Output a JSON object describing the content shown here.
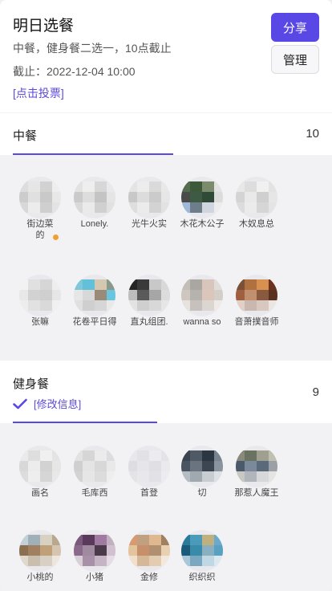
{
  "header": {
    "title": "明日选餐",
    "subtitle": "中餐，健身餐二选一，10点截止",
    "deadline": "截止：2022-12-04 10:00",
    "vote_link": "[点击投票]",
    "share_label": "分享",
    "manage_label": "管理"
  },
  "sections": [
    {
      "title": "中餐",
      "count": "10",
      "voters": [
        {
          "name": "街边菜",
          "name2": "的",
          "palette": [
            "#ddd",
            "#e6e6e6",
            "#d2d2d2",
            "#eee",
            "#ccc",
            "#e0e0e0",
            "#c9c9c9",
            "#e8e8e8",
            "#d8d8d8",
            "#ececec",
            "#cfcfcf",
            "#e3e3e3"
          ]
        },
        {
          "name": "Lonely.",
          "palette": [
            "#e2e2e2",
            "#eee",
            "#d7d7d7",
            "#e9e9e9",
            "#cacaca",
            "#ddd",
            "#c4c4c4",
            "#e5e5e5",
            "#d9d9d9",
            "#eaeaea",
            "#d0d0d0",
            "#e1e1e1"
          ]
        },
        {
          "name": "光牛火实",
          "palette": [
            "#e4e4e4",
            "#ececec",
            "#dadada",
            "#e8e8e8",
            "#c8c8c8",
            "#dcdcdc",
            "#cbcbcb",
            "#e6e6e6",
            "#dedede",
            "#ebebeb",
            "#d3d3d3",
            "#e2e2e2"
          ]
        },
        {
          "name": "木花木公子",
          "palette": [
            "#556b4d",
            "#3c5a3a",
            "#7a8c6c",
            "#e2e2e2",
            "#4a4a4a",
            "#3e5a44",
            "#2f4a36",
            "#dcdcdc",
            "#a0b8d8",
            "#6d7d8a",
            "#d0d6e0",
            "#ececec"
          ]
        },
        {
          "name": "木奴息总",
          "palette": [
            "#e8e8e8",
            "#dddddd",
            "#f0f0f0",
            "#e3e3e3",
            "#d4d4d4",
            "#e9e9e9",
            "#cfcfcf",
            "#e6e6e6",
            "#dcdcdc",
            "#ebebeb",
            "#d6d6d6",
            "#e4e4e4"
          ]
        },
        {
          "name": "张嘛",
          "palette": [
            "#f2f2f2",
            "#e0e0e0",
            "#d6d6d6",
            "#eeeeee",
            "#e8e8e8",
            "#d2d2d2",
            "#cfcfcf",
            "#e6e6e6",
            "#ededed",
            "#e1e1e1",
            "#d9d9d9",
            "#f0f0f0"
          ]
        },
        {
          "name": "花卷平日得",
          "palette": [
            "#7fc8d8",
            "#62c0d8",
            "#d4c8b0",
            "#8a9a8a",
            "#e6e6e6",
            "#d8d8d8",
            "#9a8a7a",
            "#6ac6de",
            "#e0e0e0",
            "#cfcfcf",
            "#d6d6d6",
            "#e9e9e9"
          ]
        },
        {
          "name": "直丸组团.",
          "palette": [
            "#262626",
            "#3a3a3a",
            "#c8c8c8",
            "#d8d8d8",
            "#bdbdbd",
            "#5a5a5a",
            "#a6a6a6",
            "#dcdcdc",
            "#e3e3e3",
            "#cfcfcf",
            "#d8d8d8",
            "#e6e6e6"
          ]
        },
        {
          "name": "wanna so",
          "palette": [
            "#c4beb8",
            "#aaa6a2",
            "#d8c6bc",
            "#e0dcd8",
            "#cfc6c0",
            "#b6b2ae",
            "#dcc6bc",
            "#d4cec8",
            "#e6e2de",
            "#c8c0bc",
            "#dcd6d0",
            "#eeeae6"
          ]
        },
        {
          "name": "音萧撲音师",
          "palette": [
            "#7a5038",
            "#b07040",
            "#d89050",
            "#6a3020",
            "#a06040",
            "#c09070",
            "#8a5a40",
            "#5a3020",
            "#e0d0c8",
            "#c8b8b0",
            "#d8c8c0",
            "#ece6e2"
          ]
        }
      ]
    },
    {
      "title": "健身餐",
      "count": "9",
      "edit_label": "[修改信息]",
      "voters": [
        {
          "name": "画名",
          "palette": [
            "#eaeaea",
            "#dedede",
            "#f0f0f0",
            "#e4e4e4",
            "#d8d8d8",
            "#ececec",
            "#d2d2d2",
            "#e6e6e6",
            "#dddddd",
            "#eeeeee",
            "#d6d6d6",
            "#e8e8e8"
          ]
        },
        {
          "name": "毛库西",
          "palette": [
            "#e2e2e2",
            "#d6d6d6",
            "#ebebeb",
            "#dddddd",
            "#cfcfcf",
            "#e4e4e4",
            "#d8d8d8",
            "#e9e9e9",
            "#d3d3d3",
            "#e6e6e6",
            "#dcdcdc",
            "#eeeeee"
          ]
        },
        {
          "name": "首登",
          "palette": [
            "#e8e8ec",
            "#e2e2e6",
            "#ececf0",
            "#e4e4e8",
            "#dedee2",
            "#e6e6ea",
            "#e0e0e4",
            "#eaeaee",
            "#e4e4e8",
            "#e8e8ec",
            "#e2e2e6",
            "#ececf0"
          ]
        },
        {
          "name": "切",
          "palette": [
            "#3a4450",
            "#505a66",
            "#2c3642",
            "#7a8490",
            "#4a5460",
            "#6a7480",
            "#3c4652",
            "#8a949e",
            "#b4bcc4",
            "#a0a8b0",
            "#c8cdd2",
            "#dde0e4"
          ]
        },
        {
          "name": "那惹人魔王",
          "palette": [
            "#8a8a7a",
            "#6a7262",
            "#a0a090",
            "#c0c0b0",
            "#4a5a6a",
            "#7a8a9a",
            "#5a6a7a",
            "#9aa0a6",
            "#c8c8c0",
            "#b0b6bc",
            "#d6d8da",
            "#e4e4e2"
          ]
        },
        {
          "name": "小桃的",
          "palette": [
            "#c4d0d8",
            "#a0b0b8",
            "#d8d0c0",
            "#b8a890",
            "#8a7050",
            "#a08060",
            "#c0a078",
            "#d4c4b0",
            "#e0d8cc",
            "#cabeae",
            "#d8d0c4",
            "#ece6dc"
          ]
        },
        {
          "name": "小猪",
          "palette": [
            "#7a5a7a",
            "#5a3a5a",
            "#a07aa0",
            "#c0b0c0",
            "#8a6a8a",
            "#a08aa0",
            "#4a3a4a",
            "#d0c0d0",
            "#d8d0d8",
            "#a890a8",
            "#c4b4c4",
            "#e6dce6"
          ]
        },
        {
          "name": "金修",
          "palette": [
            "#d89a70",
            "#c0a080",
            "#e0b890",
            "#a08060",
            "#e4c49c",
            "#c8906a",
            "#b09070",
            "#e8d0b0",
            "#f0e0cc",
            "#d4b898",
            "#e4ccb0",
            "#f2e8dc"
          ]
        },
        {
          "name": "织织织",
          "palette": [
            "#2a7a9a",
            "#4a9aba",
            "#c0b080",
            "#6aaacc",
            "#1a5a7a",
            "#3a8aaa",
            "#8ab0c0",
            "#5aa0c0",
            "#a8c8d8",
            "#7aa8c0",
            "#c0d8e4",
            "#dce8f0"
          ]
        }
      ]
    }
  ]
}
